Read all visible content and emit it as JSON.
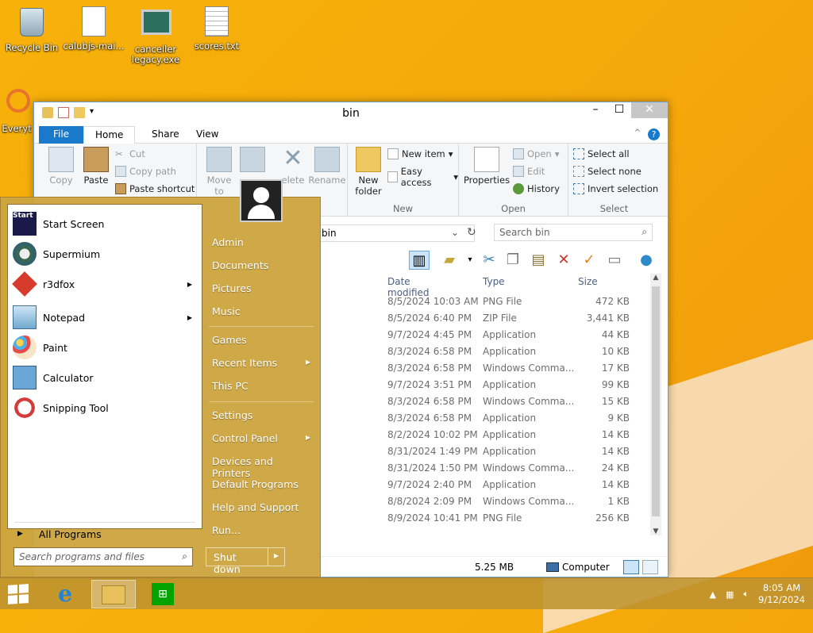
{
  "desktop": {
    "icons": [
      {
        "label": "Recycle Bin"
      },
      {
        "label": "calubjs-mai..."
      },
      {
        "label": "canceller legacy.exe"
      },
      {
        "label": "scores.txt"
      },
      {
        "label": "Everyt"
      }
    ]
  },
  "explorer": {
    "title": "bin",
    "tabs": [
      "File",
      "Home",
      "Share",
      "View"
    ],
    "ribbon": {
      "clipboard": {
        "copy": "Copy",
        "paste": "Paste",
        "cut": "Cut",
        "copy_path": "Copy path",
        "paste_shortcut": "Paste shortcut"
      },
      "organize": {
        "move_to": "Move to",
        "delete": "elete",
        "rename": "Rename"
      },
      "new": {
        "new_folder": "New folder",
        "new_item": "New item",
        "easy_access": "Easy access",
        "label": "New"
      },
      "open": {
        "properties": "Properties",
        "open": "Open",
        "edit": "Edit",
        "history": "History",
        "label": "Open"
      },
      "select": {
        "select_all": "Select all",
        "select_none": "Select none",
        "invert": "Invert selection",
        "label": "Select"
      }
    },
    "address": {
      "path": "bin",
      "search_placeholder": "Search bin"
    },
    "columns": {
      "date": "Date modified",
      "type": "Type",
      "size": "Size"
    },
    "rows": [
      {
        "date": "8/5/2024 10:03 AM",
        "type": "PNG File",
        "size": "472 KB"
      },
      {
        "date": "8/5/2024 6:40 PM",
        "type": "ZIP File",
        "size": "3,441 KB"
      },
      {
        "date": "9/7/2024 4:45 PM",
        "type": "Application",
        "size": "44 KB"
      },
      {
        "date": "8/3/2024 6:58 PM",
        "type": "Application",
        "size": "10 KB"
      },
      {
        "date": "8/3/2024 6:58 PM",
        "type": "Windows Comma...",
        "size": "17 KB"
      },
      {
        "date": "9/7/2024 3:51 PM",
        "type": "Application",
        "size": "99 KB"
      },
      {
        "date": "8/3/2024 6:58 PM",
        "type": "Windows Comma...",
        "size": "15 KB"
      },
      {
        "date": "8/3/2024 6:58 PM",
        "type": "Application",
        "size": "9 KB"
      },
      {
        "date": "8/2/2024 10:02 PM",
        "type": "Application",
        "size": "14 KB"
      },
      {
        "date": "8/31/2024 1:49 PM",
        "type": "Application",
        "size": "14 KB"
      },
      {
        "date": "8/31/2024 1:50 PM",
        "type": "Windows Comma...",
        "size": "24 KB"
      },
      {
        "date": "9/7/2024 2:40 PM",
        "type": "Application",
        "size": "14 KB"
      },
      {
        "date": "8/8/2024 2:09 PM",
        "type": "Windows Comma...",
        "size": "1 KB"
      },
      {
        "date": "8/9/2024 10:41 PM",
        "type": "PNG File",
        "size": "256 KB"
      }
    ],
    "status": {
      "size": "5.25 MB",
      "computer": "Computer"
    }
  },
  "start_menu": {
    "programs": [
      {
        "label": "Start Screen",
        "icon": "start-screen-icon",
        "icon_text": "Start",
        "has_arrow": false
      },
      {
        "label": "Supermium",
        "icon": "supermium-icon",
        "has_arrow": false
      },
      {
        "label": "r3dfox",
        "icon": "r3dfox-icon",
        "has_arrow": true
      },
      {
        "label": "Notepad",
        "icon": "notepad-icon",
        "has_arrow": true
      },
      {
        "label": "Paint",
        "icon": "paint-icon",
        "has_arrow": false
      },
      {
        "label": "Calculator",
        "icon": "calculator-icon",
        "has_arrow": false
      },
      {
        "label": "Snipping Tool",
        "icon": "snipping-tool-icon",
        "has_arrow": false
      }
    ],
    "all_programs": "All Programs",
    "search_placeholder": "Search programs and files",
    "right_items": [
      {
        "label": "Admin",
        "has_arrow": false
      },
      {
        "label": "Documents",
        "has_arrow": false
      },
      {
        "label": "Pictures",
        "has_arrow": false
      },
      {
        "label": "Music",
        "has_arrow": false
      },
      {
        "label": "Games",
        "has_arrow": false
      },
      {
        "label": "Recent Items",
        "has_arrow": true
      },
      {
        "label": "This PC",
        "has_arrow": false
      },
      {
        "label": "Settings",
        "has_arrow": false
      },
      {
        "label": "Control Panel",
        "has_arrow": true
      },
      {
        "label": "Devices and Printers",
        "has_arrow": false
      },
      {
        "label": "Default Programs",
        "has_arrow": false
      },
      {
        "label": "Help and Support",
        "has_arrow": false
      },
      {
        "label": "Run...",
        "has_arrow": false
      }
    ],
    "shutdown": "Shut down"
  },
  "taskbar": {
    "time": "8:05 AM",
    "date": "9/12/2024"
  }
}
